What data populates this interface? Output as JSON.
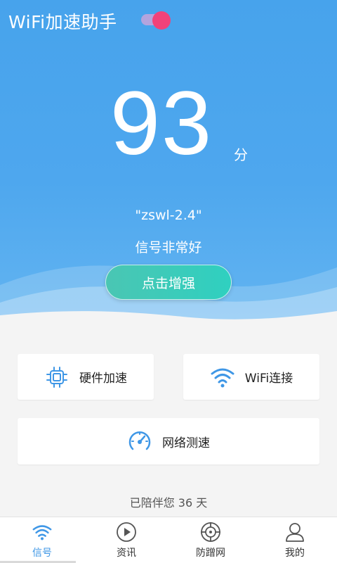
{
  "header": {
    "title": "WiFi加速助手",
    "toggle_on": true
  },
  "score": {
    "value": "93",
    "unit": "分"
  },
  "network": {
    "ssid": "\"zswl-2.4\"",
    "quality": "信号非常好"
  },
  "boost_button": {
    "label": "点击增强"
  },
  "cards": {
    "hardware": {
      "label": "硬件加速",
      "icon": "chip-icon"
    },
    "wifi": {
      "label": "WiFi连接",
      "icon": "wifi-icon"
    },
    "speed": {
      "label": "网络测速",
      "icon": "speedometer-icon"
    }
  },
  "footer": {
    "days_text": "已陪伴您 36 天"
  },
  "tabs": [
    {
      "label": "信号",
      "icon": "wifi-signal-icon",
      "active": true
    },
    {
      "label": "资讯",
      "icon": "play-icon",
      "active": false
    },
    {
      "label": "防蹭网",
      "icon": "target-icon",
      "active": false
    },
    {
      "label": "我的",
      "icon": "user-icon",
      "active": false
    }
  ],
  "colors": {
    "accent": "#3f97e6",
    "hero": "#4ea7ee",
    "boost": "#2fd0c0",
    "toggle_knob": "#f2427a"
  }
}
